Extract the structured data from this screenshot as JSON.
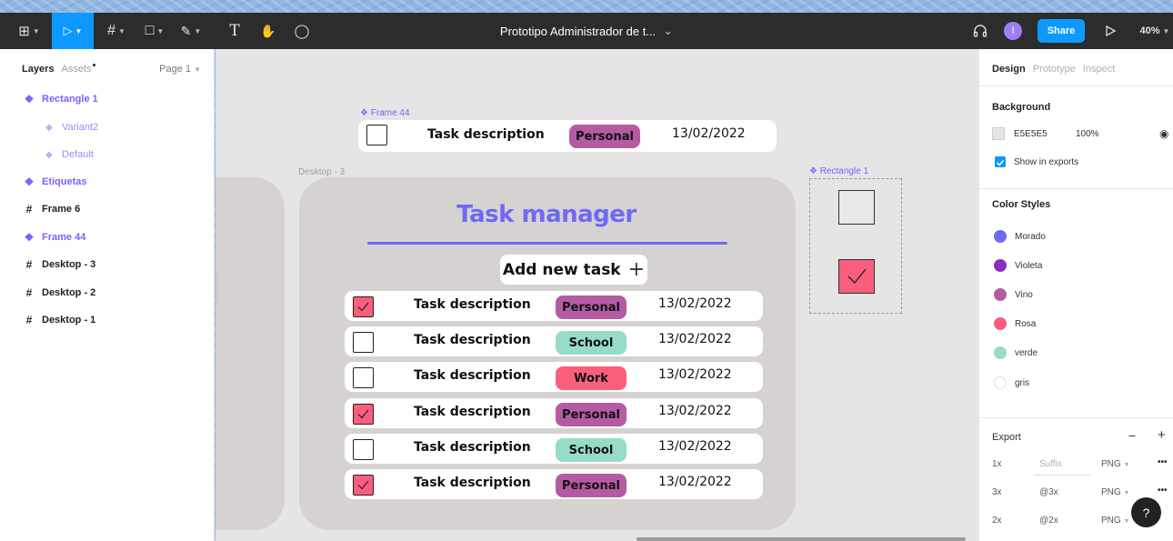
{
  "toolbar": {
    "figma_menu": "⊞",
    "move_tool": "▷",
    "frame_tool": "#",
    "shape_tool": "□",
    "pen_tool": "✎",
    "text_tool": "T",
    "hand_tool": "✋",
    "comment_tool": "◯",
    "file_title": "Prototipo Administrador de t...",
    "file_chevron": "⌄",
    "avatar_initial": "I",
    "share_label": "Share",
    "zoom": "40%",
    "accent": "#0d99ff"
  },
  "left_panel": {
    "tabs": {
      "layers": "Layers",
      "assets": "Assets"
    },
    "page": "Page 1",
    "layers": [
      {
        "name": "Rectangle 1",
        "kind": "component",
        "icon": "component-icon"
      },
      {
        "name": "Variant2",
        "kind": "variant",
        "icon": "variant-icon"
      },
      {
        "name": "Default",
        "kind": "variant",
        "icon": "variant-icon"
      },
      {
        "name": "Etiquetas",
        "kind": "component",
        "icon": "component-icon"
      },
      {
        "name": "Frame 6",
        "kind": "frame",
        "icon": "frame-icon"
      },
      {
        "name": "Frame 44",
        "kind": "component",
        "icon": "component-icon"
      },
      {
        "name": "Desktop - 3",
        "kind": "frame",
        "icon": "frame-icon"
      },
      {
        "name": "Desktop - 2",
        "kind": "frame",
        "icon": "frame-icon"
      },
      {
        "name": "Desktop - 1",
        "kind": "frame",
        "icon": "frame-icon"
      }
    ]
  },
  "canvas": {
    "frame44_label": "Frame 44",
    "desktop3_label": "Desktop - 3",
    "rect1_label": "Rectangle 1",
    "frame44_row": {
      "description": "Task description",
      "tag": "Personal",
      "date": "13/02/2022",
      "checked": false
    },
    "app": {
      "title": "Task manager",
      "add_task": "Add new task",
      "add_icon": "+",
      "title_color": "#6d69f5",
      "tasks": [
        {
          "description": "Task description",
          "tag": "Personal",
          "tag_color": "#b55ba4",
          "date": "13/02/2022",
          "checked": true
        },
        {
          "description": "Task description",
          "tag": "School",
          "tag_color": "#96dcc8",
          "date": "13/02/2022",
          "checked": false
        },
        {
          "description": "Task description",
          "tag": "Work",
          "tag_color": "#fa5e7d",
          "date": "13/02/2022",
          "checked": false
        },
        {
          "description": "Task description",
          "tag": "Personal",
          "tag_color": "#b55ba4",
          "date": "13/02/2022",
          "checked": true
        },
        {
          "description": "Task description",
          "tag": "School",
          "tag_color": "#96dcc8",
          "date": "13/02/2022",
          "checked": false
        },
        {
          "description": "Task description",
          "tag": "Personal",
          "tag_color": "#b55ba4",
          "date": "13/02/2022",
          "checked": true
        }
      ]
    }
  },
  "right_panel": {
    "tabs": {
      "design": "Design",
      "prototype": "Prototype",
      "inspect": "Inspect"
    },
    "background": {
      "title": "Background",
      "hex": "E5E5E5",
      "opacity": "100%",
      "show_in_exports": "Show in exports"
    },
    "color_styles": {
      "title": "Color Styles",
      "items": [
        {
          "name": "Morado",
          "color": "#6d69f5"
        },
        {
          "name": "Violeta",
          "color": "#8a2fc0"
        },
        {
          "name": "Vino",
          "color": "#b55ba4"
        },
        {
          "name": "Rosa",
          "color": "#fa5e7d"
        },
        {
          "name": "verde",
          "color": "#96dcc8"
        },
        {
          "name": "gris",
          "color": "#ffffff"
        }
      ]
    },
    "export": {
      "title": "Export",
      "minus": "−",
      "plus": "+",
      "rows": [
        {
          "scale": "1x",
          "suffix": "Suffix",
          "format": "PNG"
        },
        {
          "scale": "3x",
          "suffix": "@3x",
          "format": "PNG"
        },
        {
          "scale": "2x",
          "suffix": "@2x",
          "format": "PNG"
        }
      ],
      "more": "•••"
    },
    "help": "?"
  }
}
